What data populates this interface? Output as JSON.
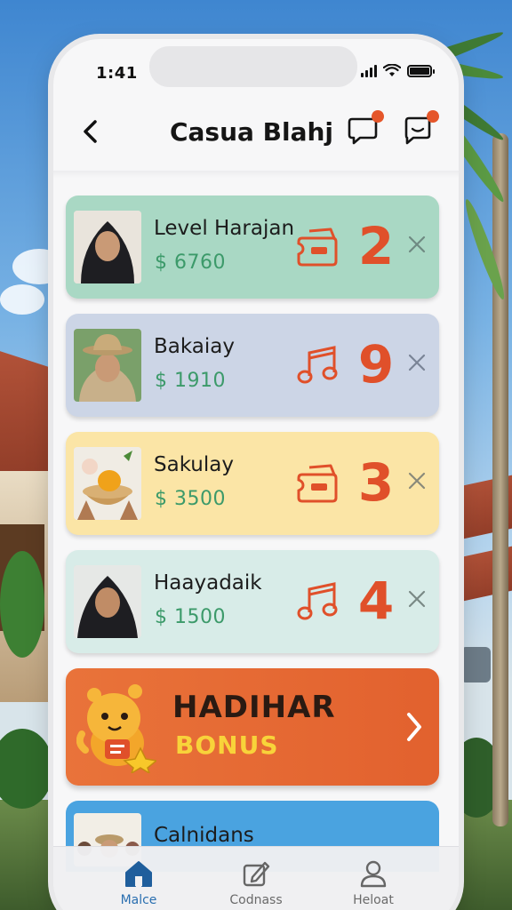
{
  "status_bar": {
    "time": "1:41"
  },
  "header": {
    "title": "Casua Blahj"
  },
  "cards": [
    {
      "name": "Level Harajan",
      "price": "$ 6760",
      "count": "2",
      "bg": "#a9d8c4",
      "icon": "ticket-icon"
    },
    {
      "name": "Bakaiay",
      "price": "$ 1910",
      "count": "9",
      "bg": "#ccd5e6",
      "icon": "music-note-icon"
    },
    {
      "name": "Sakulay",
      "price": "$ 3500",
      "count": "3",
      "bg": "#fbe5a6",
      "icon": "ticket-icon"
    },
    {
      "name": "Haayadaik",
      "price": "$ 1500",
      "count": "4",
      "bg": "#d8ece8",
      "icon": "music-note-icon"
    }
  ],
  "bonus": {
    "title": "HADIHAR",
    "subtitle": "BONUS"
  },
  "partial_card": {
    "name": "Calnidans"
  },
  "bottom_nav": [
    {
      "label": "Malce",
      "icon": "home-icon",
      "active": true
    },
    {
      "label": "Codnass",
      "icon": "edit-icon",
      "active": false
    },
    {
      "label": "Heloat",
      "icon": "profile-icon",
      "active": false
    }
  ],
  "colors": {
    "accent": "#e0502a",
    "price": "#3c9a6a",
    "bonus_bg": "#e2612e",
    "bonus_text": "#f8d33a",
    "nav_active": "#2a6fb0"
  }
}
